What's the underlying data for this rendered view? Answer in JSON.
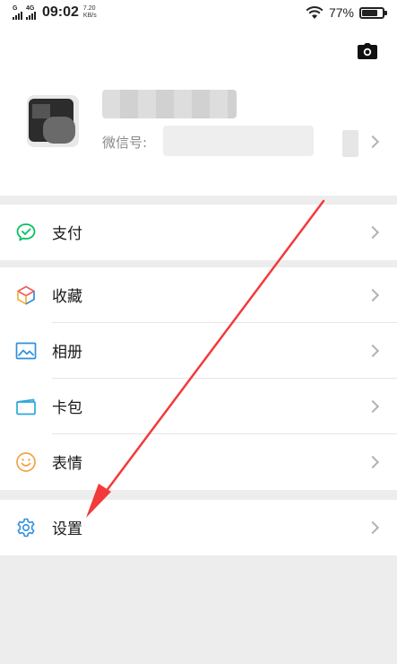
{
  "status_bar": {
    "sim1_tag": "G",
    "sim2_tag": "4G",
    "time": "09:02",
    "net_speed_value": "7.20",
    "net_speed_unit": "KB/s",
    "battery_percent": "77%",
    "battery_level": 0.77
  },
  "profile": {
    "wechat_id_label": "微信号:"
  },
  "menu": {
    "pay_label": "支付",
    "favorites_label": "收藏",
    "album_label": "相册",
    "cards_label": "卡包",
    "stickers_label": "表情",
    "settings_label": "设置"
  },
  "icons": {
    "camera": "camera-icon",
    "pay": "pay-icon",
    "favorites": "favorites-cube-icon",
    "album": "album-image-icon",
    "cards": "card-wallet-icon",
    "stickers": "smiley-icon",
    "settings": "gear-icon"
  },
  "colors": {
    "pay_green": "#07c160",
    "album_blue": "#2f8fde",
    "stickers_orange": "#f2a344",
    "settings_blue": "#2f8fde",
    "annotation_red": "#f23a3a"
  }
}
